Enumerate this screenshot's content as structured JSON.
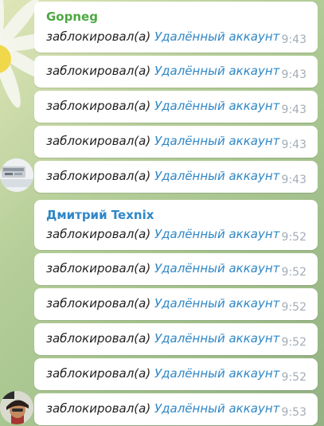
{
  "groups": [
    {
      "sender": "Gopneg",
      "sender_color": "#4da843",
      "messages": [
        {
          "action": "заблокировал(а)",
          "target": "Удалённый аккаунт",
          "time": "9:43"
        },
        {
          "action": "заблокировал(а)",
          "target": "Удалённый аккаунт",
          "time": "9:43"
        },
        {
          "action": "заблокировал(а)",
          "target": "Удалённый аккаунт",
          "time": "9:43"
        },
        {
          "action": "заблокировал(а)",
          "target": "Удалённый аккаунт",
          "time": "9:43"
        },
        {
          "action": "заблокировал(а)",
          "target": "Удалённый аккаунт",
          "time": "9:43"
        }
      ]
    },
    {
      "sender": "Дмитрий Texnix",
      "sender_color": "#2f87c6",
      "messages": [
        {
          "action": "заблокировал(а)",
          "target": "Удалённый аккаунт",
          "time": "9:52"
        },
        {
          "action": "заблокировал(а)",
          "target": "Удалённый аккаунт",
          "time": "9:52"
        },
        {
          "action": "заблокировал(а)",
          "target": "Удалённый аккаунт",
          "time": "9:52"
        },
        {
          "action": "заблокировал(а)",
          "target": "Удалённый аккаунт",
          "time": "9:52"
        },
        {
          "action": "заблокировал(а)",
          "target": "Удалённый аккаунт",
          "time": "9:52"
        },
        {
          "action": "заблокировал(а)",
          "target": "Удалённый аккаунт",
          "time": "9:53"
        }
      ]
    }
  ],
  "colors": {
    "link": "#2f87c6",
    "time": "#a3adb6",
    "bubble": "#ffffff"
  }
}
